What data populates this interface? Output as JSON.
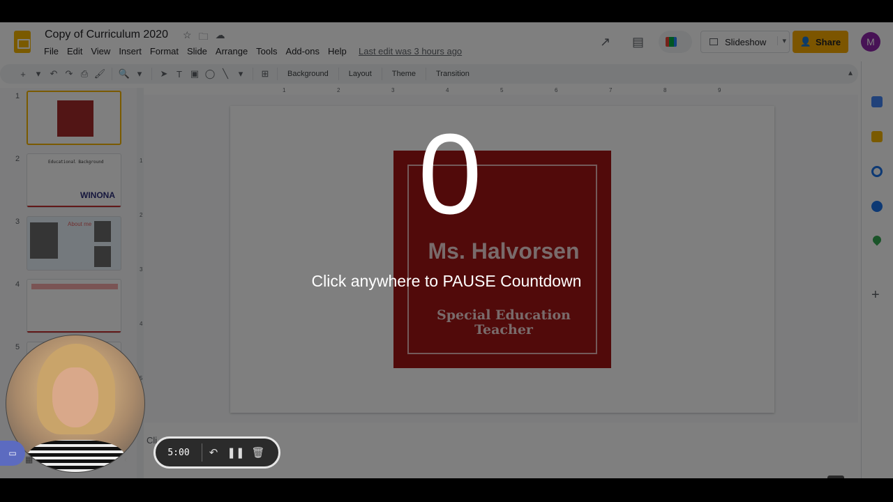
{
  "doc": {
    "title": "Copy of Curriculum 2020",
    "last_edit": "Last edit was 3 hours ago"
  },
  "menu": [
    "File",
    "Edit",
    "View",
    "Insert",
    "Format",
    "Slide",
    "Arrange",
    "Tools",
    "Add-ons",
    "Help"
  ],
  "header": {
    "slideshow_label": "Slideshow",
    "share_label": "Share",
    "avatar_initial": "M"
  },
  "toolbar": {
    "background": "Background",
    "layout": "Layout",
    "theme": "Theme",
    "transition": "Transition"
  },
  "ruler": {
    "h": [
      "1",
      "2",
      "3",
      "4",
      "5",
      "6",
      "7",
      "8",
      "9"
    ],
    "v": [
      "1",
      "2",
      "3",
      "4",
      "5"
    ]
  },
  "filmstrip": {
    "slides": [
      {
        "num": "1",
        "title": "Ms. Halvorsen"
      },
      {
        "num": "2",
        "title": "Educational Background",
        "logo_text": "WINONA"
      },
      {
        "num": "3",
        "title": "About me"
      },
      {
        "num": "4"
      },
      {
        "num": "5"
      }
    ]
  },
  "slide": {
    "name": "Ms. Halvorsen",
    "role_line1": "Special Education",
    "role_line2": "Teacher",
    "color": "#a31515"
  },
  "notes": {
    "text": "Cli"
  },
  "overlay": {
    "countdown": "0",
    "message": "Click anywhere to PAUSE Countdown"
  },
  "recorder": {
    "time": "5:00"
  },
  "colors": {
    "accent": "#f4b400",
    "share": "#f9ab00",
    "avatar": "#8e24aa"
  }
}
